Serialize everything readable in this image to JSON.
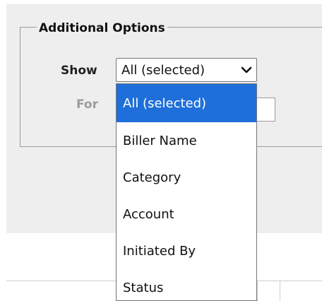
{
  "fieldset": {
    "legend": "Additional Options"
  },
  "show": {
    "label": "Show",
    "selected": "All (selected)",
    "options": [
      "All (selected)",
      "Biller Name",
      "Category",
      "Account",
      "Initiated By",
      "Status"
    ]
  },
  "for": {
    "label": "For"
  },
  "colors": {
    "highlight": "#1e6fd9",
    "panel": "#eeeeee"
  }
}
